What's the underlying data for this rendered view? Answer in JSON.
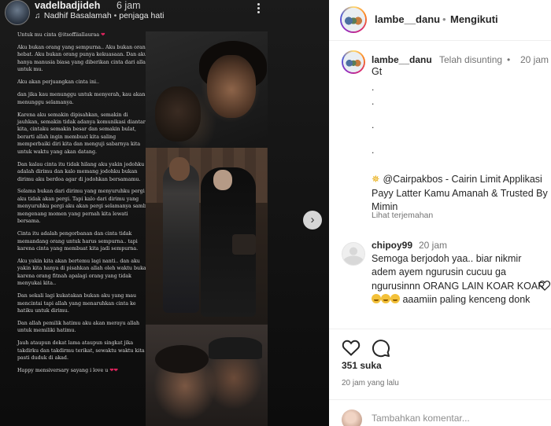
{
  "story": {
    "username": "vadelbadjideh",
    "time": "6 jam",
    "music_artist": "Nadhif Basalamah",
    "music_title": "penjaga hati",
    "text_blocks": [
      "Untuk mu cinta @itsoffiiallauraa",
      "Aku bukan orang yang sempurna.. Aku bukan orang hebat. Aku bukan orang punya kekuasaan. Dan aku hanya manusia biasa yang diberikan cinta dari allah untuk mu.",
      "Aku akan perjuangkan cinta ini..",
      "dan jika kau menunggu untuk menyerah, kau akan menunggu selamanya.",
      "Karena aku semakin dipisahkan, semakin di jauhkan, semakin tidak adanya komunikasi diantara kita, cintaku semakin besar dan semakin bulat, berarti allah ingin membuat kita saling memperbaiki diri kita dan menguji sabarnya kita untuk waktu yang akan datang.",
      "Dan kalau cinta itu tidak hilang aku yakin jodohku adalah dirimu dan kalo memang jodohku bukan dirimu aku berdoa agar di jodohkan bersamamu.",
      "Selama bukan dari dirimu yang menyuruhku pergi aku tidak akan pergi. Tapi kalo dari dirimu yang menyuruhku pergi aku akan pergi selamanya sambil mengenang momen yang pernah kita lewati bersama.",
      "Cinta itu adalah pengorbanan dan cinta tidak memandang orang untuk harus sempurna.. tapi karena cinta yang membuat kita jadi sempurna.",
      "Aku yakin kita akan bertemu lagi nanti.. dan aku yakin kita hanya di pisahkan allah oleh waktu bukan karena orang fitnah apalagi orang yang tidak menyukai kita..",
      "Dan sekali lagi kukatakan bukan aku yang mau mencintai tapi allah yang menaruhkan cinta ke hatiku untuk dirimu.",
      "Dan allah pemilik hatimu aku akan merayu allah untuk memiliki hatimu.",
      "Jauh ataupun dekat lama ataupun singkat jika takdirku dan takdirmu terikat, sewaktu waktu kita pasti duduk di akad.",
      "Happy mensiversary sayang i love u"
    ]
  },
  "post": {
    "username": "lambe__danu",
    "follow_sep": "•",
    "follow_status": "Mengikuti",
    "caption": {
      "username": "lambe__danu",
      "edited": "Telah disunting",
      "sep": "•",
      "time": "20 jam",
      "text": "Gt",
      "dots": [
        ".",
        ".",
        ".",
        "."
      ],
      "promo": "@Cairpakbos - Cairin Limit Applikasi Payy Latter Kamu Amanah & Trusted By Mimin",
      "see_translation": "Lihat terjemahan"
    },
    "comment": {
      "username": "chipoy99",
      "time": "20 jam",
      "text_before": "Semoga berjodoh yaa.. biar nikmir adem ayem ngurusin cucuu ga ngurusinnn ORANG LAIN KOAR KOAR",
      "text_after": "aaamiin paling kenceng donk"
    },
    "likes": "351 suka",
    "age": "20 jam yang lalu",
    "add_comment_placeholder": "Tambahkan komentar..."
  },
  "colors": {
    "story_bg": "#121212",
    "text_primary": "#262626",
    "text_secondary": "#737373",
    "heart": "#e0245e"
  },
  "icons": [
    "music-note-icon",
    "more-options-icon",
    "next-arrow-icon",
    "heart-icon",
    "comment-icon",
    "star-icon",
    "emoji-icon"
  ]
}
